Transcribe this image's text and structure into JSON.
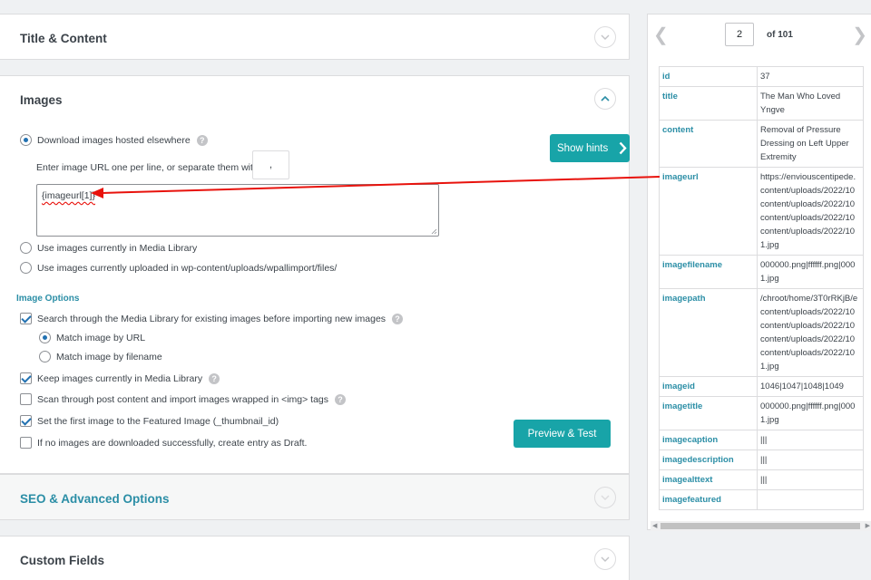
{
  "panels": {
    "title_content": "Title & Content",
    "images": "Images",
    "seo": "SEO & Advanced Options",
    "custom_fields": "Custom Fields"
  },
  "images": {
    "download_label": "Download images hosted elsewhere",
    "separator_label": "Enter image URL one per line, or separate them with a",
    "separator_value": ",",
    "textarea_value": "{imageurl[1]}",
    "media_library_label": "Use images currently in Media Library",
    "uploaded_label": "Use images currently uploaded in wp-content/uploads/wpallimport/files/",
    "show_hints": "Show hints",
    "options_heading": "Image Options",
    "search_media_label": "Search through the Media Library for existing images before importing new images",
    "match_url_label": "Match image by URL",
    "match_filename_label": "Match image by filename",
    "keep_images_label": "Keep images currently in Media Library",
    "scan_content_label": "Scan through post content and import images wrapped in <img> tags",
    "featured_label": "Set the first image to the Featured Image (_thumbnail_id)",
    "draft_label": "If no images are downloaded successfully, create entry as Draft.",
    "preview_test": "Preview & Test",
    "help_glyph": "?"
  },
  "record": {
    "page": "2",
    "of_label": "of 101",
    "rows": [
      {
        "key": "id",
        "lines": [
          "37"
        ]
      },
      {
        "key": "title",
        "lines": [
          "The Man Who Loved",
          "Yngve"
        ]
      },
      {
        "key": "content",
        "lines": [
          "Removal of Pressure",
          "Dressing on Left Upper",
          "Extremity"
        ]
      },
      {
        "key": "imageurl",
        "lines": [
          "https://enviouscentipede.",
          "content/uploads/2022/10",
          "content/uploads/2022/10",
          "content/uploads/2022/10",
          "content/uploads/2022/10",
          "1.jpg"
        ]
      },
      {
        "key": "imagefilename",
        "lines": [
          "000000.png|ffffff.png|000",
          "1.jpg"
        ]
      },
      {
        "key": "imagepath",
        "lines": [
          "/chroot/home/3T0rRKjB/e",
          "content/uploads/2022/10",
          "content/uploads/2022/10",
          "content/uploads/2022/10",
          "content/uploads/2022/10",
          "1.jpg"
        ]
      },
      {
        "key": "imageid",
        "lines": [
          "1046|1047|1048|1049"
        ]
      },
      {
        "key": "imagetitle",
        "lines": [
          "000000.png|ffffff.png|000",
          "1.jpg"
        ]
      },
      {
        "key": "imagecaption",
        "lines": [
          "|||"
        ]
      },
      {
        "key": "imagedescription",
        "lines": [
          "|||"
        ]
      },
      {
        "key": "imagealttext",
        "lines": [
          "|||"
        ]
      },
      {
        "key": "imagefeatured",
        "lines": [
          ""
        ]
      }
    ]
  },
  "colors": {
    "accent": "#18a4a8",
    "link": "#2b8ea6",
    "arrow": "#e8120c"
  }
}
